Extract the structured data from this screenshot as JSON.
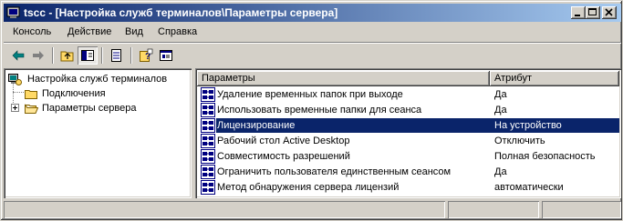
{
  "window": {
    "title": "tscc - [Настройка служб терминалов\\Параметры сервера]",
    "title_color": "#0a246a"
  },
  "menu": {
    "items": [
      "Консоль",
      "Действие",
      "Вид",
      "Справка"
    ]
  },
  "toolbar": {
    "buttons": [
      "back-arrow-icon",
      "forward-arrow-icon",
      "up-folder-icon",
      "show-tree-icon",
      "export-list-icon",
      "help-icon",
      "properties-icon"
    ]
  },
  "tree": {
    "root": "Настройка служб терминалов",
    "children": [
      "Подключения",
      "Параметры сервера"
    ]
  },
  "list": {
    "columns": [
      "Параметры",
      "Атрибут"
    ],
    "rows": [
      {
        "name": "Удаление временных папок при выходе",
        "attr": "Да"
      },
      {
        "name": "Использовать временные папки для сеанса",
        "attr": "Да"
      },
      {
        "name": "Лицензирование",
        "attr": "На устройство"
      },
      {
        "name": "Рабочий стол Active Desktop",
        "attr": "Отключить"
      },
      {
        "name": "Совместимость разрешений",
        "attr": "Полная безопасность"
      },
      {
        "name": "Ограничить пользователя единственным сеансом",
        "attr": "Да"
      },
      {
        "name": "Метод обнаружения сервера лицензий",
        "attr": "автоматически"
      }
    ],
    "selected_index": 2,
    "selection_color": "#0a246a"
  }
}
